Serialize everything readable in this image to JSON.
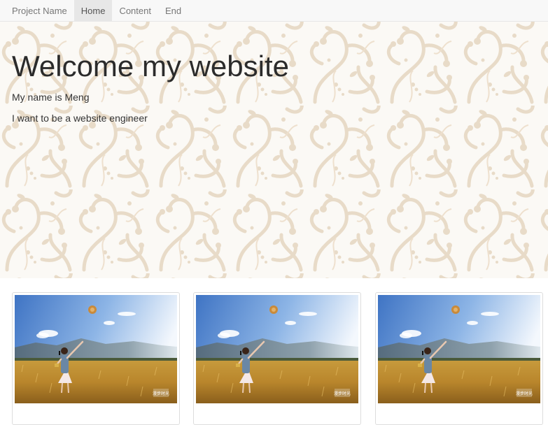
{
  "navbar": {
    "brand": "Project Name",
    "items": [
      {
        "label": "Home",
        "active": true
      },
      {
        "label": "Content",
        "active": false
      },
      {
        "label": "End",
        "active": false
      }
    ]
  },
  "hero": {
    "title": "Welcome my website",
    "line1": "My name is Meng",
    "line2": "I want to be a website engineer"
  },
  "thumbnails": [
    {
      "image": "photo-girl-wheat-field-balloon",
      "watermark": "漫步时光"
    },
    {
      "image": "photo-girl-wheat-field-balloon",
      "watermark": "漫步时光"
    },
    {
      "image": "photo-girl-wheat-field-balloon",
      "watermark": "漫步时光"
    }
  ],
  "colors": {
    "navbar_bg": "#f8f8f8",
    "active_tab_bg": "#e7e7e7",
    "pattern": "#e3d3bb",
    "hero_bg": "#fbf8f3"
  }
}
